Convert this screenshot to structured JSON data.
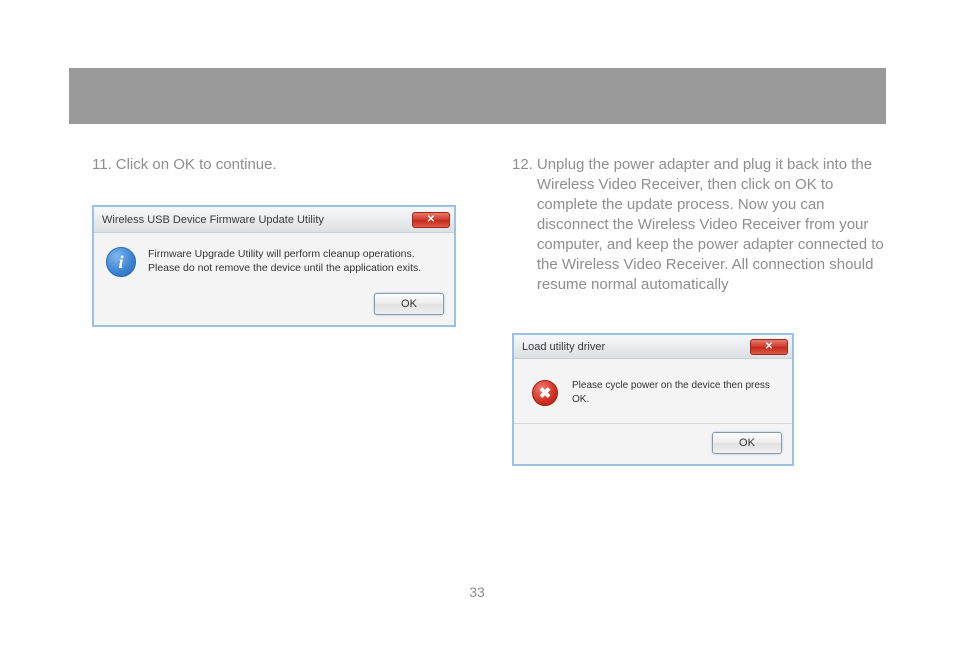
{
  "page_number": "33",
  "step11": {
    "number": "11.",
    "text": "Click on OK to continue."
  },
  "step12": {
    "number": "12.",
    "text": "Unplug the power adapter and plug it back into the Wireless Video Receiver, then click on OK to complete the update process. Now you can disconnect the Wireless Video Receiver from your computer, and keep the power adapter connected to the Wireless Video Receiver.  All connection should resume normal automatically"
  },
  "dialog1": {
    "title": "Wireless USB Device Firmware Update Utility",
    "message": "Firmware Upgrade Utility will perform cleanup operations. Please do not remove the device until the application exits.",
    "ok": "OK",
    "close": "✕"
  },
  "dialog2": {
    "title": "Load utility driver",
    "message": "Please cycle power on the device then press OK.",
    "ok": "OK",
    "close": "✕"
  }
}
